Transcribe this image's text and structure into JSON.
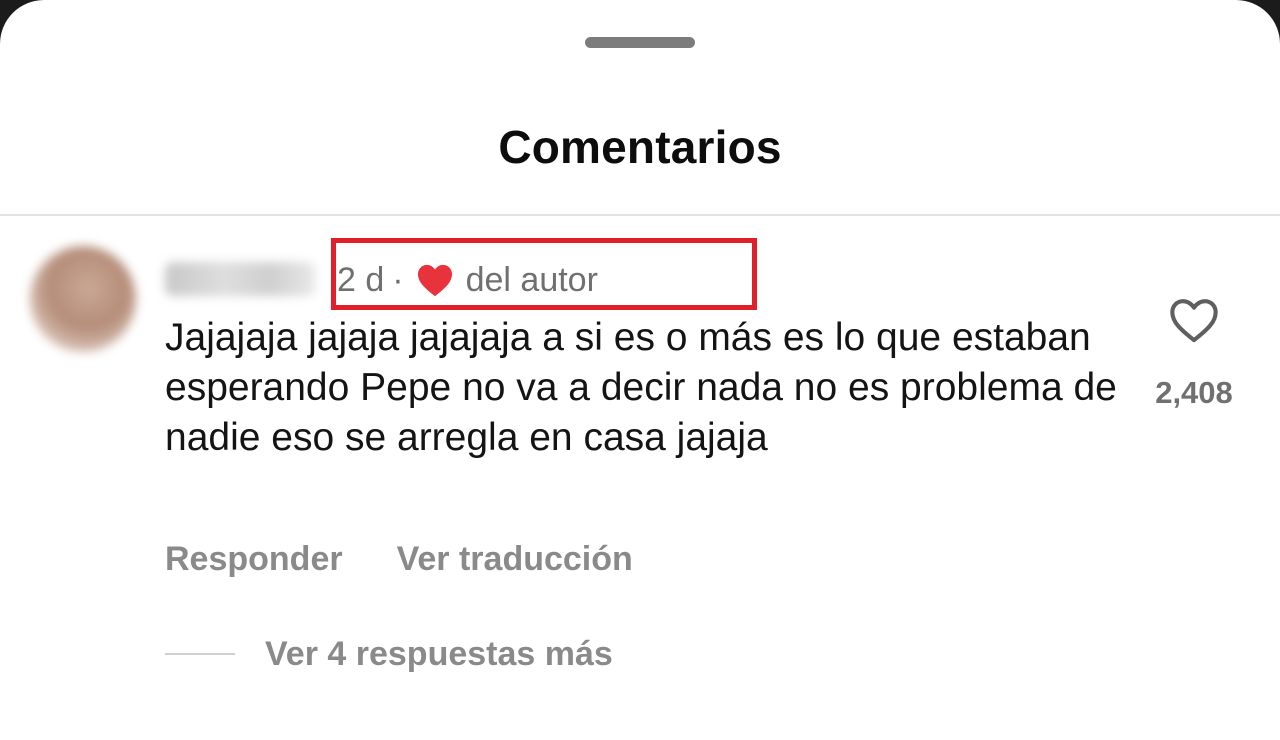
{
  "sheet": {
    "title": "Comentarios"
  },
  "comment": {
    "time": "2 d",
    "separator": "·",
    "author_like_label": "del autor",
    "text": "Jajajaja jajaja jajajaja a si es o más es lo que estaban esperando Pepe no va a decir nada no es problema de nadie eso se arregla en casa jajaja",
    "actions": {
      "reply": "Responder",
      "translate": "Ver traducción"
    },
    "like_count": "2,408",
    "view_replies": "Ver 4 respuestas más"
  },
  "icons": {
    "author_heart": "heart-filled-icon",
    "like": "heart-outline-icon"
  },
  "colors": {
    "heart_red": "#e8323c",
    "highlight_box": "#e01f2b",
    "muted_text": "#8a8a8a"
  }
}
